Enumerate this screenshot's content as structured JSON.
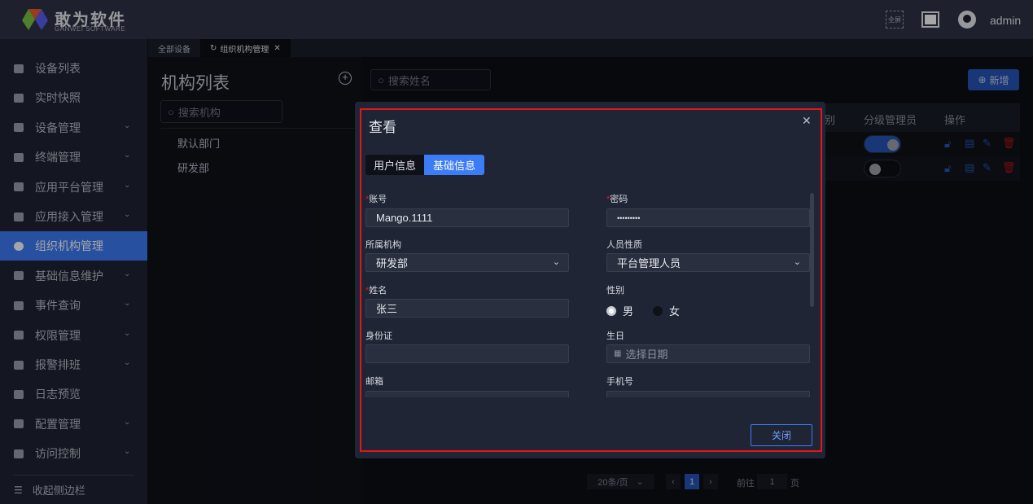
{
  "header": {
    "brand": "敢为软件",
    "brand_sub": "GANWEI SOFTWARE",
    "fullscreen_label": "全屏",
    "user": "admin"
  },
  "sidebar": {
    "items": [
      {
        "label": "设备列表",
        "icon": "monitor-icon",
        "expandable": false
      },
      {
        "label": "实时快照",
        "icon": "camera-icon",
        "expandable": false
      },
      {
        "label": "设备管理",
        "icon": "grid-icon",
        "expandable": true
      },
      {
        "label": "终端管理",
        "icon": "grid-icon",
        "expandable": true
      },
      {
        "label": "应用平台管理",
        "icon": "grid-icon",
        "expandable": true
      },
      {
        "label": "应用接入管理",
        "icon": "grid-icon",
        "expandable": true
      },
      {
        "label": "组织机构管理",
        "icon": "gear-icon",
        "expandable": false,
        "active": true
      },
      {
        "label": "基础信息维护",
        "icon": "gear-icon",
        "expandable": true
      },
      {
        "label": "事件查询",
        "icon": "document-search-icon",
        "expandable": true
      },
      {
        "label": "权限管理",
        "icon": "shield-icon",
        "expandable": true
      },
      {
        "label": "报警排班",
        "icon": "calendar-icon",
        "expandable": true
      },
      {
        "label": "日志预览",
        "icon": "document-icon",
        "expandable": false
      },
      {
        "label": "配置管理",
        "icon": "bookmark-icon",
        "expandable": true
      },
      {
        "label": "访问控制",
        "icon": "document-icon",
        "expandable": true
      }
    ],
    "collapse": "收起侧边栏"
  },
  "tabs": [
    {
      "label": "全部设备"
    },
    {
      "label": "组织机构管理",
      "active": true
    }
  ],
  "org": {
    "title": "机构列表",
    "search_placeholder": "搜索机构",
    "items": [
      "默认部门",
      "研发部"
    ]
  },
  "users": {
    "search_placeholder": "搜索姓名",
    "add": "新增",
    "columns": {
      "partial": "别",
      "sub_admin": "分级管理员",
      "actions": "操作"
    },
    "rows": [
      {
        "sub_admin": true
      },
      {
        "sub_admin": false
      }
    ]
  },
  "pagination": {
    "page_size": "20条/页",
    "current": "1",
    "goto_label": "前往",
    "goto_value": "1",
    "page_suffix": "页"
  },
  "dialog": {
    "title": "查看",
    "tabs": [
      "用户信息",
      "基础信息"
    ],
    "active_tab": 1,
    "fields": {
      "account": {
        "label": "账号",
        "value": "Mango.1111",
        "required": true
      },
      "password": {
        "label": "密码",
        "value": "•••••••••",
        "required": true
      },
      "org": {
        "label": "所属机构",
        "value": "研发部"
      },
      "person_type": {
        "label": "人员性质",
        "value": "平台管理人员"
      },
      "name": {
        "label": "姓名",
        "value": "张三",
        "required": true
      },
      "gender": {
        "label": "性别",
        "options": [
          "男",
          "女"
        ],
        "selected": "男"
      },
      "id_card": {
        "label": "身份证",
        "value": ""
      },
      "birthday": {
        "label": "生日",
        "placeholder": "选择日期"
      },
      "email": {
        "label": "邮箱",
        "value": ""
      },
      "phone": {
        "label": "手机号",
        "value": ""
      }
    },
    "close": "关闭"
  },
  "colors": {
    "accent": "#3c7cf6",
    "danger": "#e0161b",
    "dialog_bg": "#202536"
  }
}
